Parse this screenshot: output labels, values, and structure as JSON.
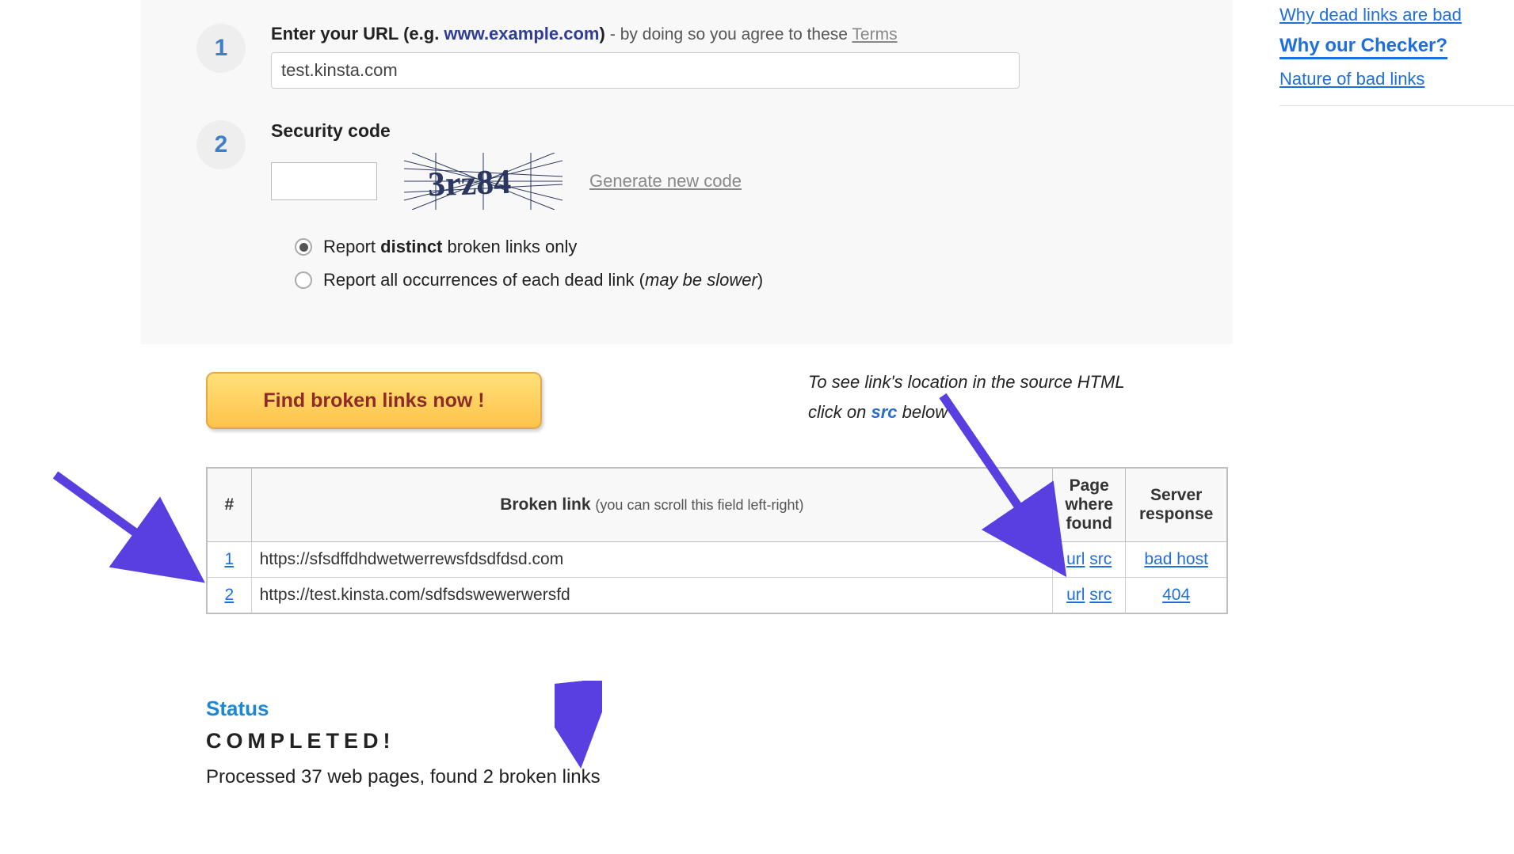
{
  "steps": {
    "one": {
      "number": "1",
      "label_prefix": "Enter your URL",
      "example_prefix": "(e.g. ",
      "example_domain": "www.example.com",
      "example_suffix": ")",
      "agree_text": " - by doing so you agree to these ",
      "terms_link": "Terms",
      "url_value": "test.kinsta.com"
    },
    "two": {
      "number": "2",
      "label": "Security code",
      "captcha_text": "3rz84",
      "generate_link": "Generate new code",
      "radio_distinct_prefix": "Report ",
      "radio_distinct_bold": "distinct",
      "radio_distinct_suffix": " broken links only",
      "radio_all_prefix": "Report all occurrences of each dead link (",
      "radio_all_italic": "may be slower",
      "radio_all_suffix": ")"
    }
  },
  "sidebar": {
    "links": [
      "Why dead links are bad",
      "Why our Checker?",
      "Nature of bad links"
    ]
  },
  "action": {
    "button_label": "Find broken links now !",
    "hint_line1": "To see link's location in the source HTML",
    "hint_line2_prefix": "click on ",
    "hint_line2_src": "src",
    "hint_line2_suffix": " below"
  },
  "table": {
    "headers": {
      "num": "#",
      "link": "Broken link",
      "link_sub": "(you can scroll this field left-right)",
      "page": "Page where found",
      "resp": "Server response"
    },
    "rows": [
      {
        "n": "1",
        "link": "https://sfsdffdhdwetwerrewsfdsdfdsd.com",
        "url": "url",
        "src": "src",
        "resp": "bad host"
      },
      {
        "n": "2",
        "link": "https://test.kinsta.com/sdfsdswewerwersfd",
        "url": "url",
        "src": "src",
        "resp": "404"
      }
    ]
  },
  "status": {
    "title": "Status",
    "completed": "COMPLETED!",
    "summary": "Processed 37 web pages, found 2 broken links"
  }
}
